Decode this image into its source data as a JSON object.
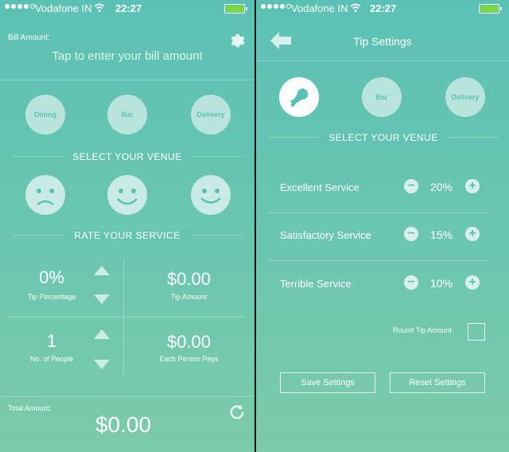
{
  "status_bar": {
    "carrier": "Vodafone IN",
    "time": "22:27",
    "battery_color": "#7bd93a",
    "signal_dots": 5,
    "signal_dots_filled": 4
  },
  "left": {
    "bill_amount_label": "Bill Amount:",
    "bill_amount_placeholder": "Tap to enter your bill amount",
    "venues": [
      "Dining",
      "Bar",
      "Delivery"
    ],
    "select_venue_label": "SELECT YOUR VENUE",
    "rate_service_label": "RATE YOUR SERVICE",
    "tip_percentage_value": "0%",
    "tip_percentage_label": "Tip Percentage",
    "tip_amount_value": "$0.00",
    "tip_amount_label": "Tip Amount",
    "people_value": "1",
    "people_label": "No. of People",
    "each_pays_value": "$0.00",
    "each_pays_label": "Each Person Pays",
    "total_label": "Total Amount:",
    "total_value": "$0.00"
  },
  "right": {
    "title": "Tip Settings",
    "venues": [
      "Bar",
      "Delivery"
    ],
    "select_venue_label": "SELECT YOUR VENUE",
    "rows": [
      {
        "label": "Excellent Service",
        "value": "20%"
      },
      {
        "label": "Satisfactory Service",
        "value": "15%"
      },
      {
        "label": "Terrible Service",
        "value": "10%"
      }
    ],
    "round_tip_label": "Round Tip Amount",
    "save_label": "Save Settings",
    "reset_label": "Reset Settings"
  },
  "colors": {
    "accent": "#5cc1b5",
    "text": "#ffffff"
  },
  "icons": [
    "gear-icon",
    "refresh-icon",
    "back-arrow-icon",
    "chicken-leg-icon",
    "wifi-icon",
    "plus-icon",
    "minus-icon"
  ]
}
